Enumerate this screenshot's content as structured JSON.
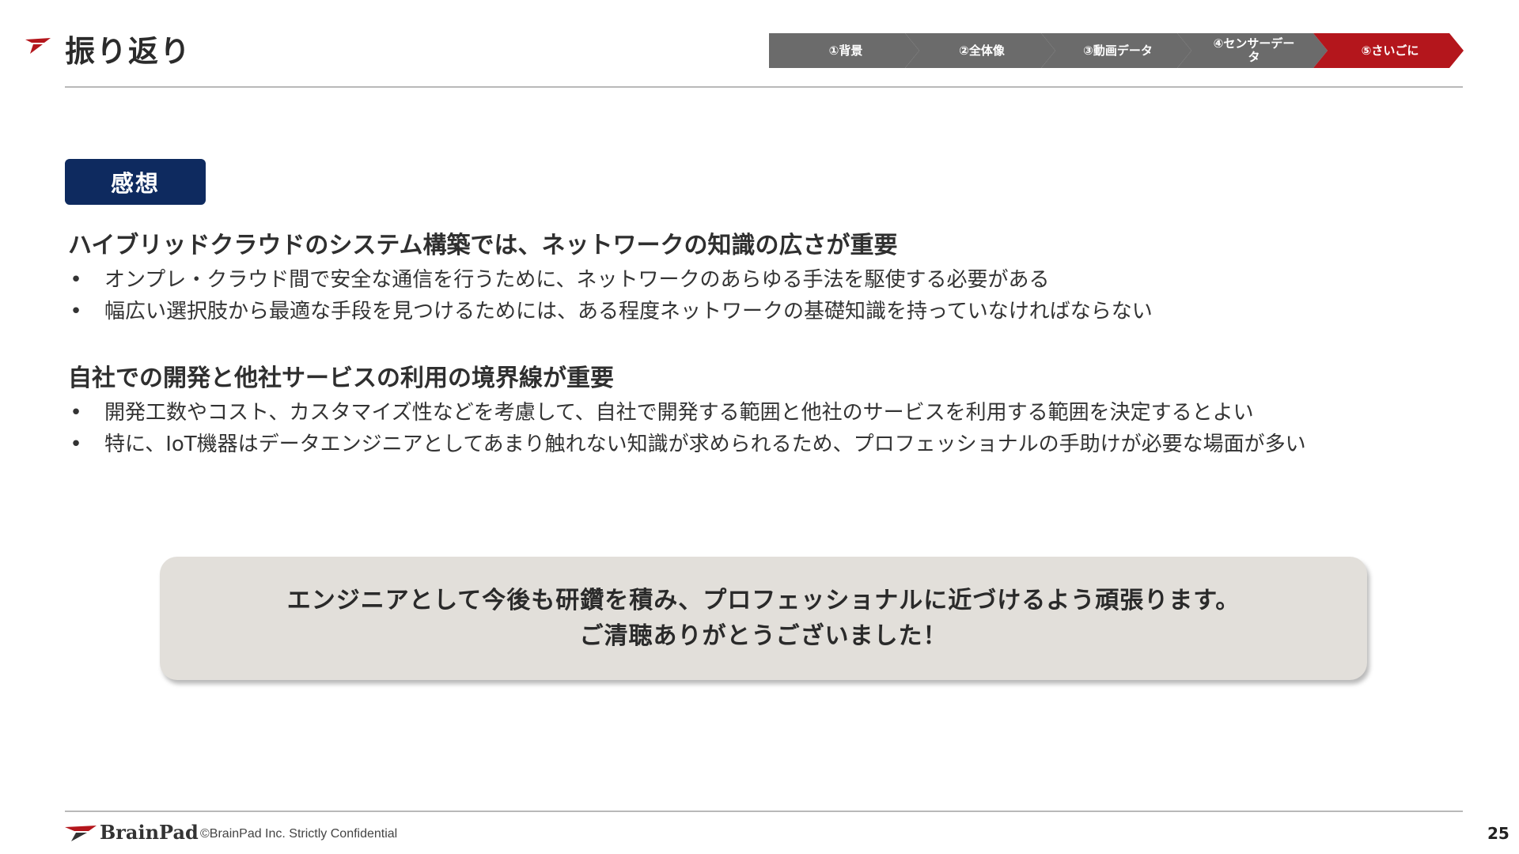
{
  "header": {
    "title": "振り返り",
    "steps": [
      {
        "label": "①背景",
        "active": false
      },
      {
        "label": "②全体像",
        "active": false
      },
      {
        "label": "③動画データ",
        "active": false
      },
      {
        "label": "④センサーデー\nタ",
        "active": false
      },
      {
        "label": "⑤さいごに",
        "active": true
      }
    ]
  },
  "section_label": "感想",
  "sections": [
    {
      "heading": "ハイブリッドクラウドのシステム構築では、ネットワークの知識の広さが重要",
      "bullets": [
        "オンプレ・クラウド間で安全な通信を行うために、ネットワークのあらゆる手法を駆使する必要がある",
        "幅広い選択肢から最適な手段を見つけるためには、ある程度ネットワークの基礎知識を持っていなければならない"
      ]
    },
    {
      "heading": "自社での開発と他社サービスの利用の境界線が重要",
      "bullets": [
        "開発工数やコスト、カスタマイズ性などを考慮して、自社で開発する範囲と他社のサービスを利用する範囲を決定するとよい",
        "特に、IoT機器はデータエンジニアとしてあまり触れない知識が求められるため、プロフェッショナルの手助けが必要な場面が多い"
      ]
    }
  ],
  "bullet_symbol": "•",
  "closing": {
    "line1": "エンジニアとして今後も研鑽を積み、プロフェッショナルに近づけるよう頑張ります。",
    "line2": "ご清聴ありがとうございました！"
  },
  "footer": {
    "brand": "BrainPad",
    "copyright": "©BrainPad Inc.  Strictly Confidential",
    "page_number": "25"
  },
  "colors": {
    "accent_red": "#b4161c",
    "navy": "#0e2a5f",
    "step_gray": "#6b6b6b",
    "closing_bg": "#e2dfda"
  }
}
